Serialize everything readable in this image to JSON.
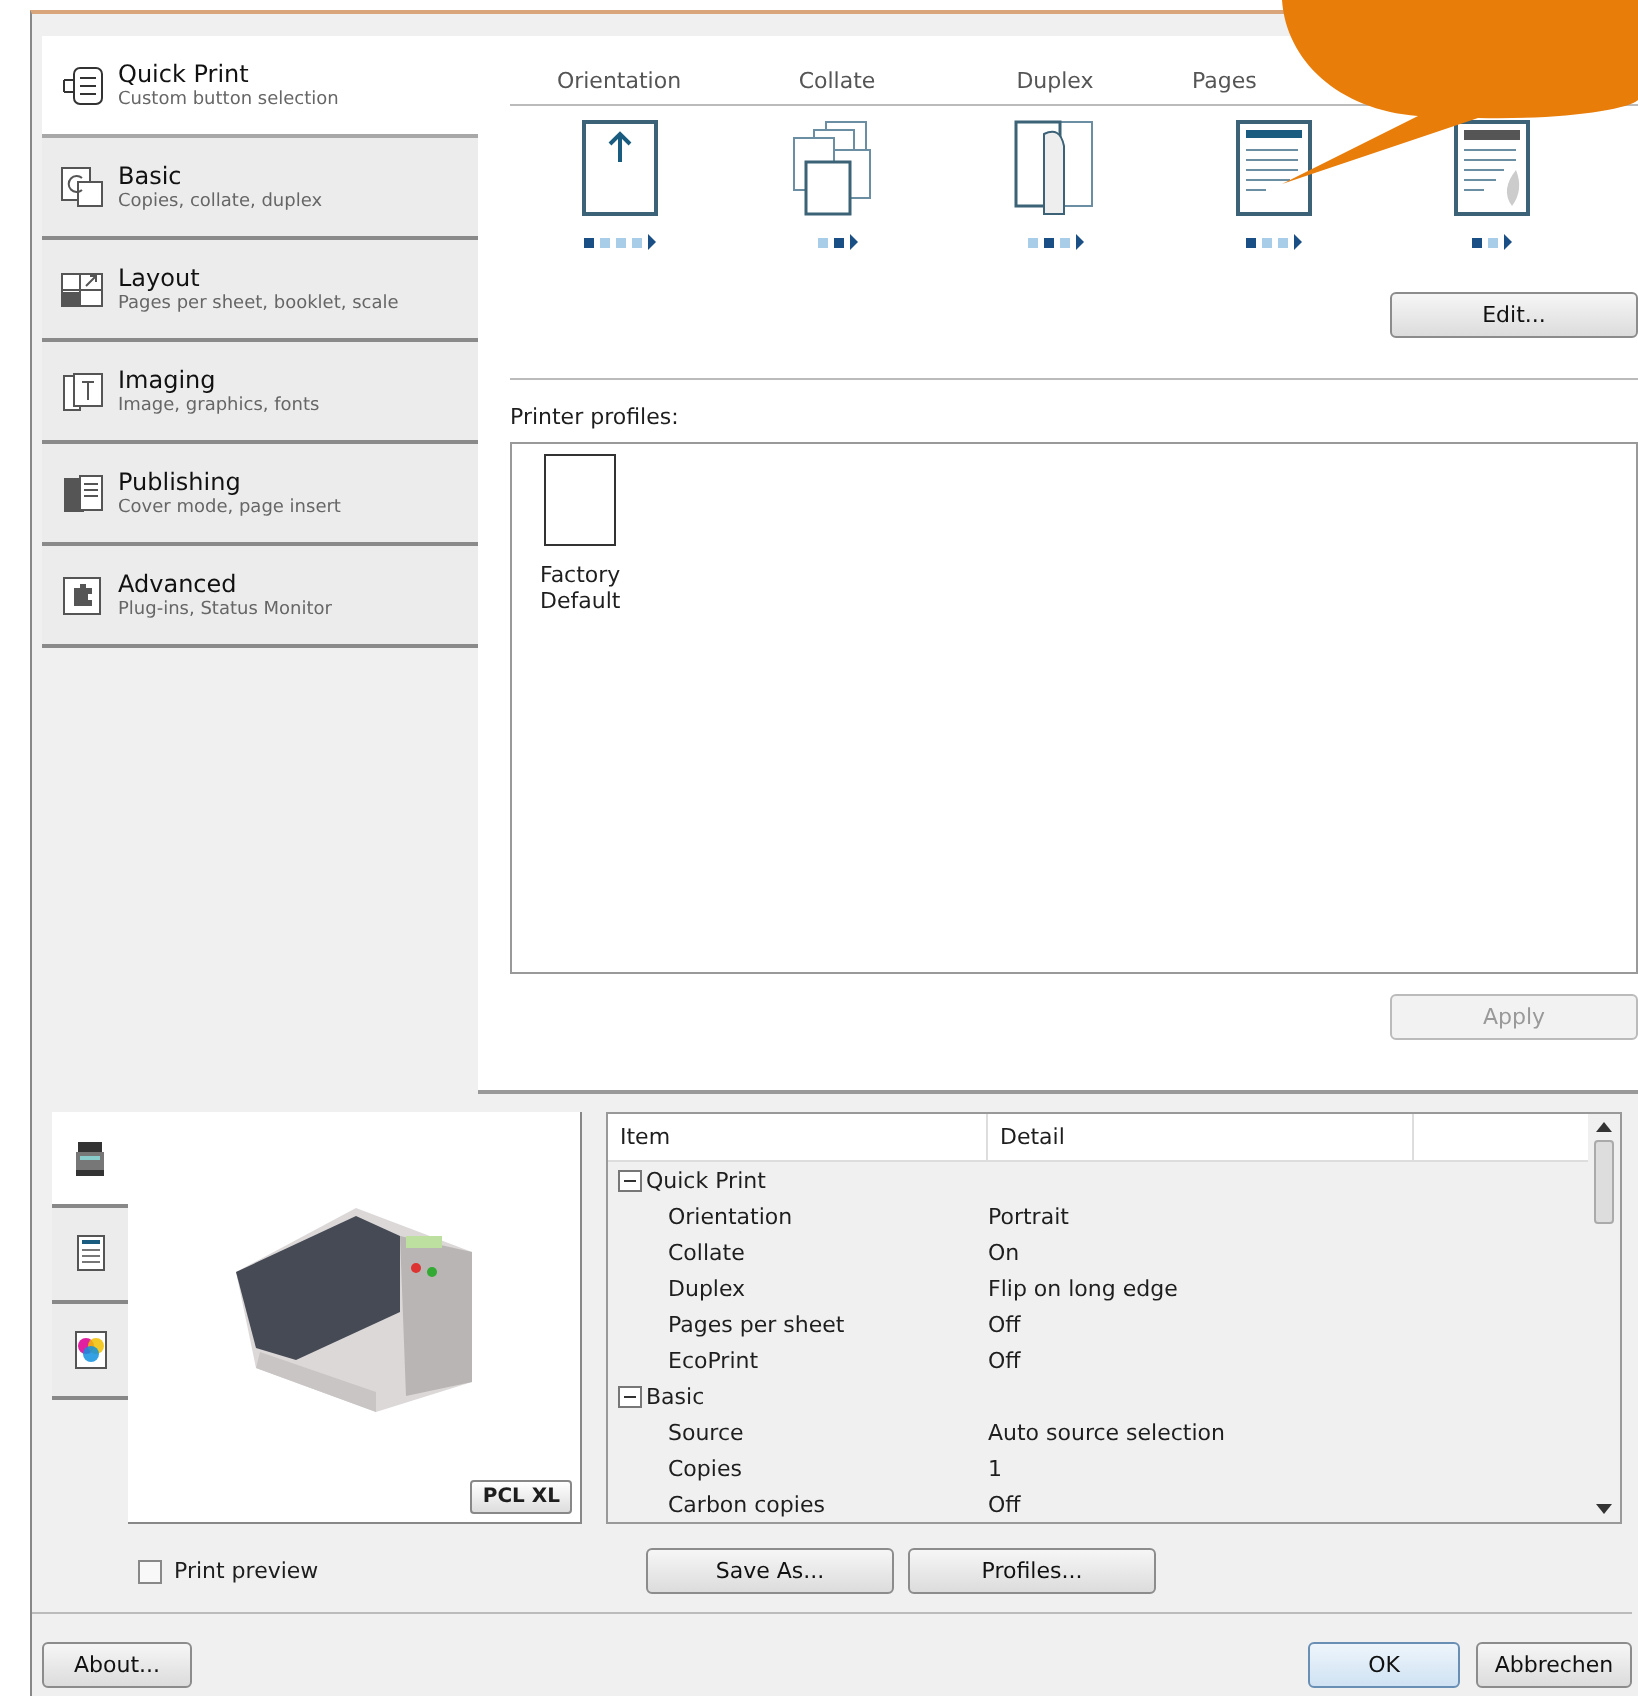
{
  "sidebar": {
    "items": [
      {
        "kind": "quickprint",
        "title": "Quick Print",
        "subtitle": "Custom button selection",
        "selected": true
      },
      {
        "kind": "basic",
        "title": "Basic",
        "subtitle": "Copies, collate, duplex",
        "selected": false
      },
      {
        "kind": "layout",
        "title": "Layout",
        "subtitle": "Pages per sheet, booklet, scale",
        "selected": false
      },
      {
        "kind": "imaging",
        "title": "Imaging",
        "subtitle": "Image, graphics, fonts",
        "selected": false
      },
      {
        "kind": "publishing",
        "title": "Publishing",
        "subtitle": "Cover mode, page insert",
        "selected": false
      },
      {
        "kind": "advanced",
        "title": "Advanced",
        "subtitle": "Plug-ins, Status Monitor",
        "selected": false
      }
    ]
  },
  "quick_buttons": [
    {
      "label": "Orientation",
      "kind": "orientation",
      "options": [
        {
          "selected": true
        },
        {
          "selected": false
        },
        {
          "selected": false
        },
        {
          "selected": false
        }
      ]
    },
    {
      "label": "Collate",
      "kind": "collate",
      "options": [
        {
          "selected": false
        },
        {
          "selected": true
        }
      ]
    },
    {
      "label": "Duplex",
      "kind": "duplex",
      "options": [
        {
          "selected": false
        },
        {
          "selected": true
        },
        {
          "selected": false
        }
      ]
    },
    {
      "label": "Pages",
      "kind": "pages",
      "options": [
        {
          "selected": true
        },
        {
          "selected": false
        },
        {
          "selected": false
        }
      ]
    },
    {
      "kind": "ecoprint",
      "options": [
        {
          "selected": true
        },
        {
          "selected": false
        }
      ]
    }
  ],
  "edit_button": "Edit...",
  "profiles": {
    "label": "Printer profiles:",
    "items": [
      {
        "name": "Factory\nDefault"
      }
    ],
    "apply_button": "Apply",
    "apply_disabled": true
  },
  "preview": {
    "tabs": [
      {
        "kind": "device",
        "selected": true
      },
      {
        "kind": "page",
        "selected": false
      },
      {
        "kind": "color",
        "selected": false
      }
    ],
    "badge": "PCL XL",
    "checkbox": {
      "label": "Print preview",
      "checked": false
    }
  },
  "summary": {
    "columns": [
      "Item",
      "Detail"
    ],
    "groups": [
      {
        "name": "Quick Print",
        "expanded": true,
        "children": [
          {
            "item": "Orientation",
            "detail": "Portrait"
          },
          {
            "item": "Collate",
            "detail": "On"
          },
          {
            "item": "Duplex",
            "detail": "Flip on long edge"
          },
          {
            "item": "Pages per sheet",
            "detail": "Off"
          },
          {
            "item": "EcoPrint",
            "detail": "Off"
          }
        ]
      },
      {
        "name": "Basic",
        "expanded": true,
        "children": [
          {
            "item": "Source",
            "detail": "Auto source selection"
          },
          {
            "item": "Copies",
            "detail": "1"
          },
          {
            "item": "Carbon copies",
            "detail": "Off"
          }
        ]
      }
    ],
    "buttons": [
      "Save As...",
      "Profiles..."
    ]
  },
  "footer": {
    "about": "About...",
    "ok": "OK",
    "cancel": "Abbrechen"
  }
}
